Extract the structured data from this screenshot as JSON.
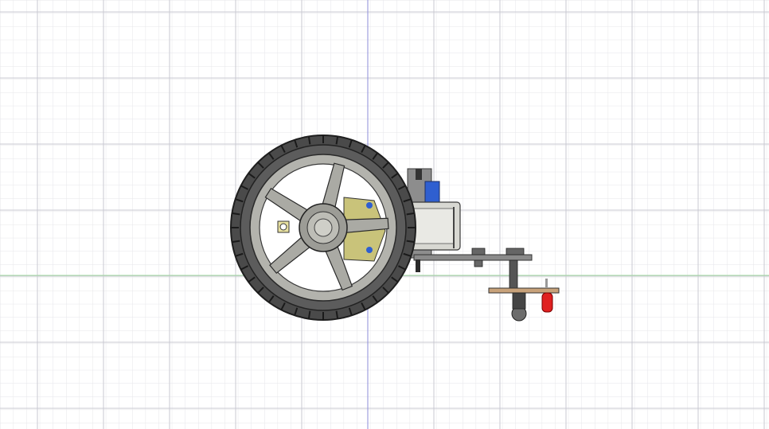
{
  "viewport": {
    "view": "side",
    "grid": {
      "visible": true,
      "minor_color": "#e6e6ea",
      "major_color": "#c9c9d2"
    },
    "axis_colors": {
      "vertical": "#8c8cd9",
      "horizontal": "#9fd89f"
    }
  },
  "model": {
    "parts": [
      {
        "part": "tire",
        "icon": "wheel-tire-icon",
        "color": "#4a4a4a"
      },
      {
        "part": "rim",
        "icon": "wheel-rim-icon",
        "color": "#b3b3ad"
      },
      {
        "part": "hub",
        "icon": "wheel-hub-icon",
        "color": "#9c9c96"
      },
      {
        "part": "gear-motor",
        "icon": "gear-motor-icon",
        "color": "#d8d8d2"
      },
      {
        "part": "motor-bracket",
        "icon": "bracket-icon",
        "color": "#c9c37a"
      },
      {
        "part": "encoder-board",
        "icon": "circuit-board-icon",
        "color": "#2f5fd0"
      },
      {
        "part": "chassis-plate",
        "icon": "plate-icon",
        "color": "#8a8a8a"
      },
      {
        "part": "caster-ball",
        "icon": "caster-icon",
        "color": "#6c6c6c"
      },
      {
        "part": "sensor-pcb",
        "icon": "pcb-icon",
        "color": "#c8a27a"
      },
      {
        "part": "led",
        "icon": "led-icon",
        "color": "#e02020"
      }
    ]
  }
}
